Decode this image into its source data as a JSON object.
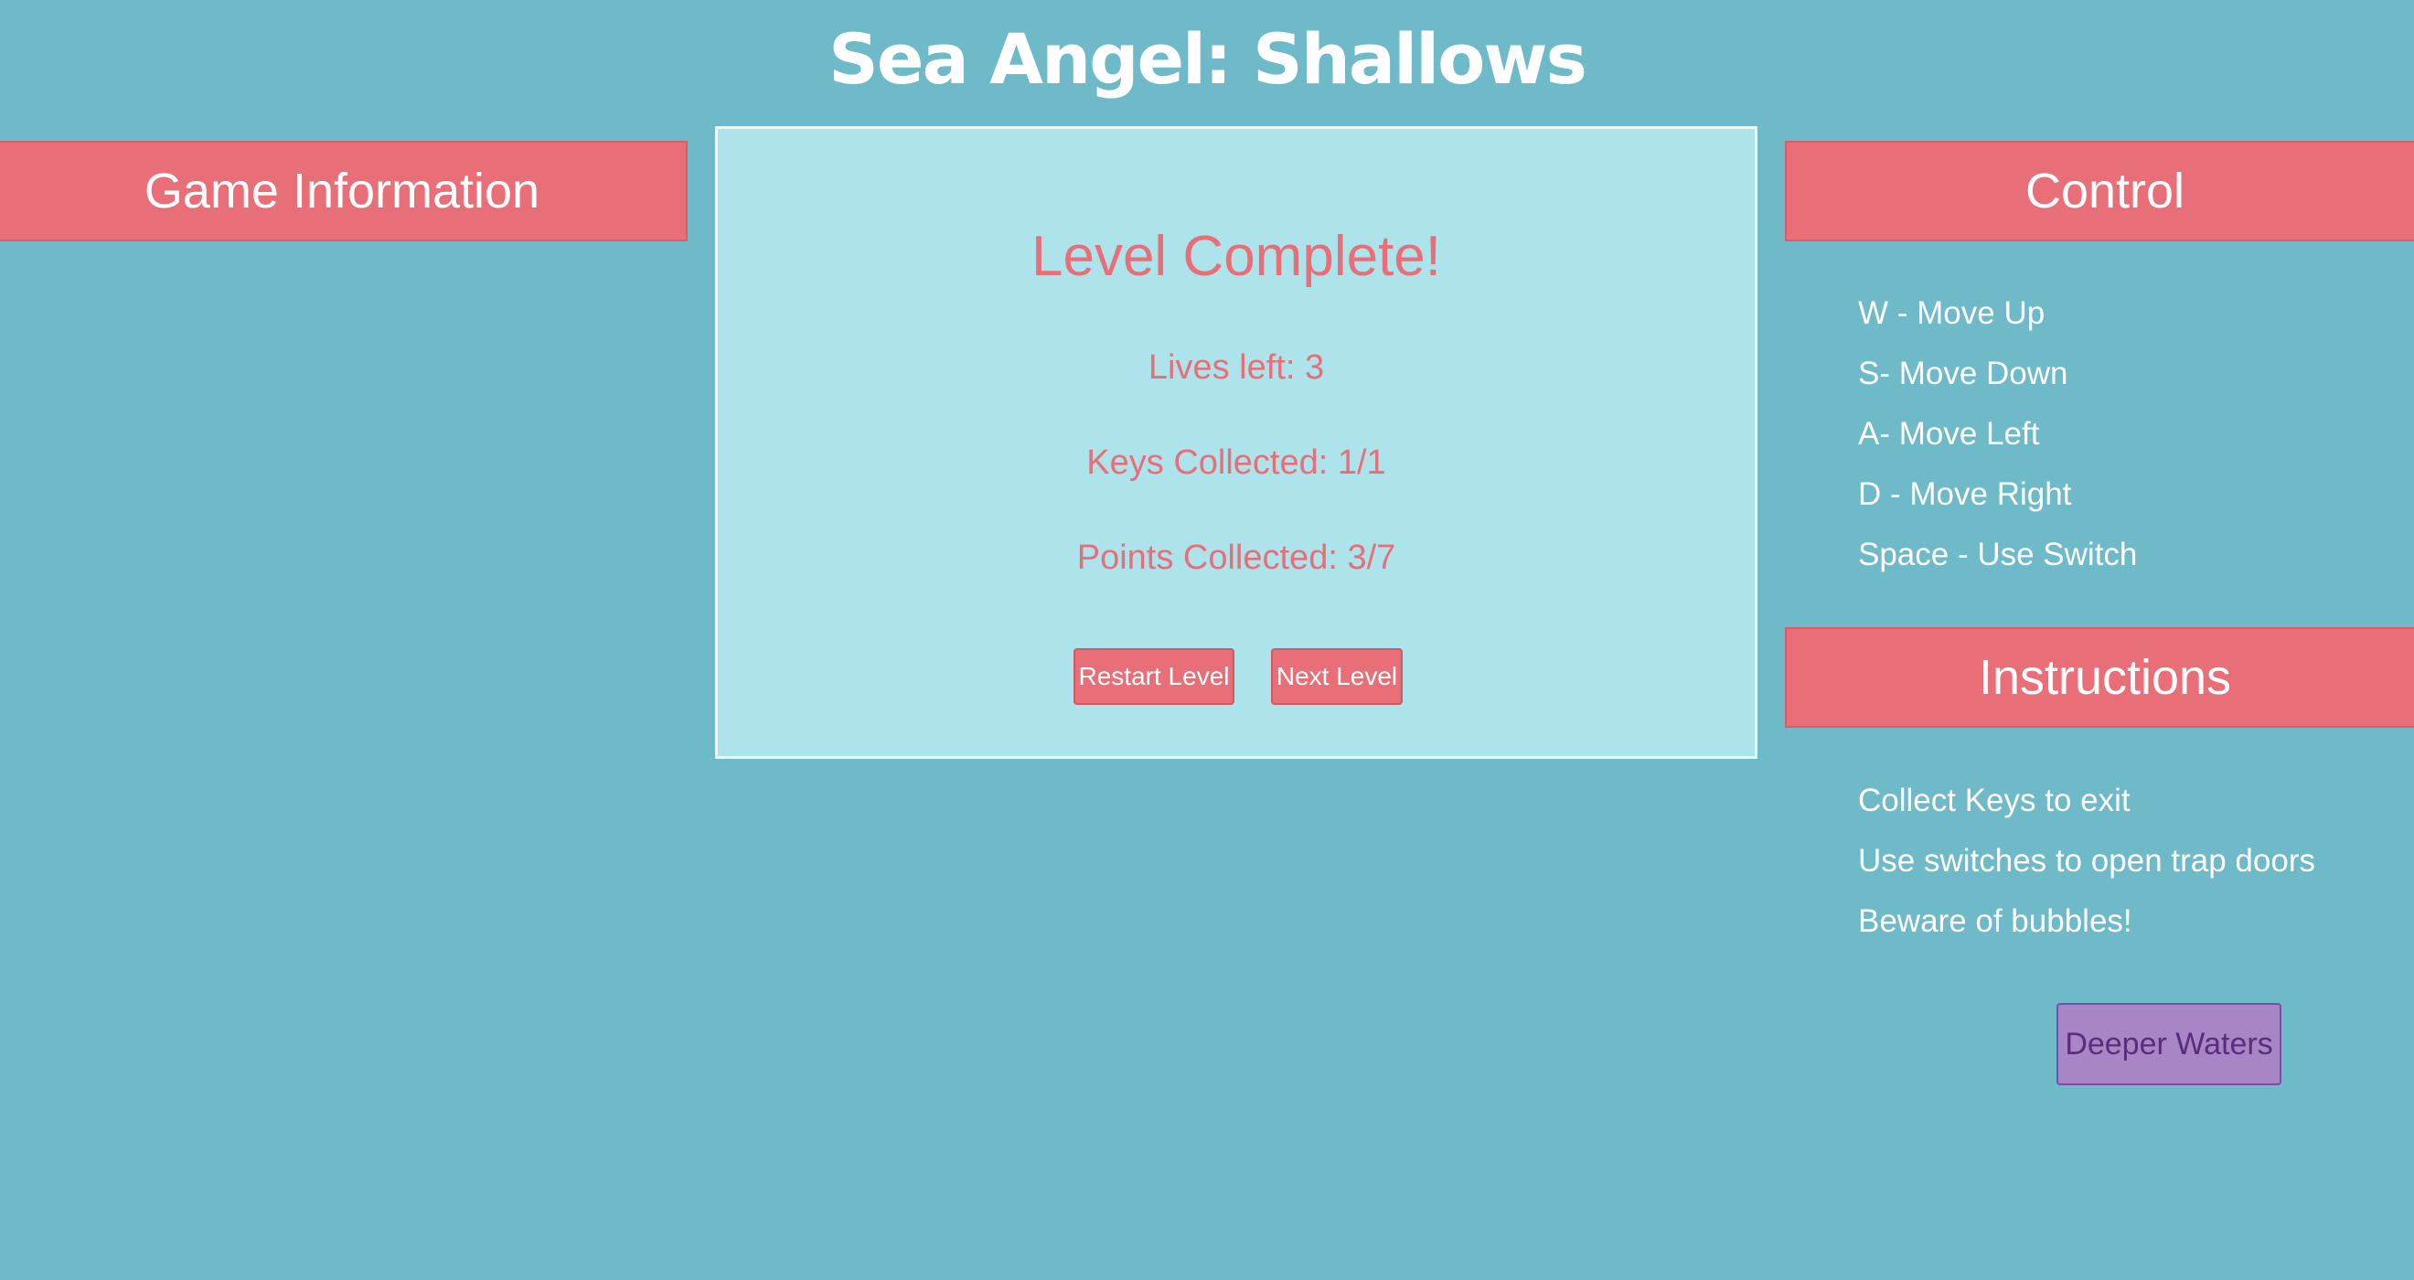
{
  "title": "Sea Angel: Shallows",
  "left_panel": {
    "header": "Game Information"
  },
  "game": {
    "heading": "Level Complete!",
    "lives": "Lives left: 3",
    "keys": "Keys Collected: 1/1",
    "points": "Points Collected: 3/7",
    "restart_label": "Restart Level",
    "next_label": "Next Level"
  },
  "control": {
    "header": "Control",
    "items": [
      "W - Move Up",
      "S- Move Down",
      "A- Move Left",
      "D - Move Right",
      "Space - Use Switch"
    ]
  },
  "instructions": {
    "header": "Instructions",
    "items": [
      "Collect Keys to exit",
      "Use switches to open trap doors",
      "Beware of bubbles!"
    ]
  },
  "deeper_button": "Deeper Waters",
  "colors": {
    "background": "#6fbac8",
    "panel_header": "#e86f78",
    "game_area": "#ade3eb",
    "accent_text": "#e86f78",
    "deeper_button": "#a886c5"
  }
}
